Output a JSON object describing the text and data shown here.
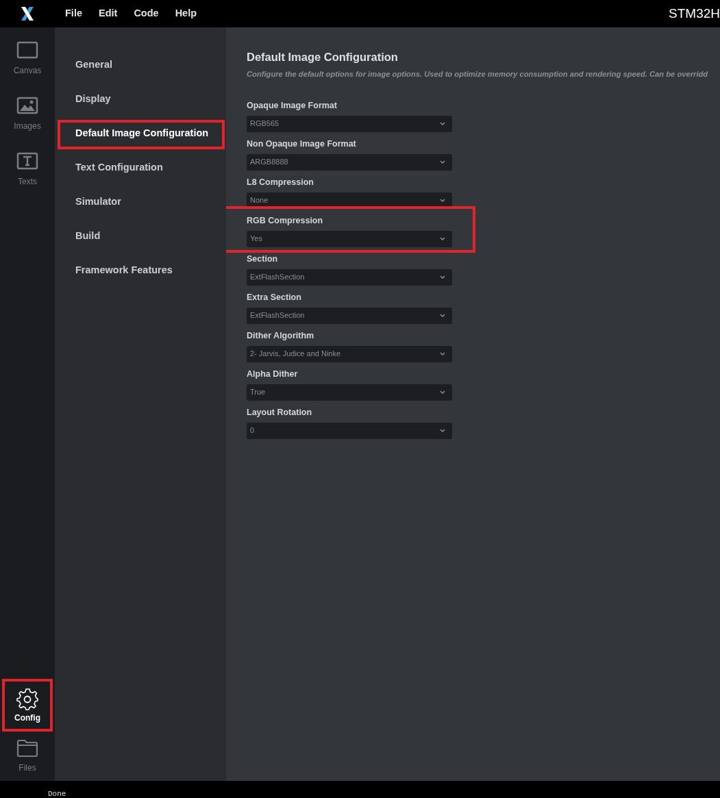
{
  "menu_bar": {
    "items": [
      "File",
      "Edit",
      "Code",
      "Help"
    ],
    "title": "STM32H"
  },
  "tool_rail": {
    "items": [
      {
        "kind": "canvas",
        "label": "Canvas",
        "selected": false,
        "highlighted": false
      },
      {
        "kind": "images",
        "label": "Images",
        "selected": false,
        "highlighted": false
      },
      {
        "kind": "texts",
        "label": "Texts",
        "selected": false,
        "highlighted": false
      }
    ],
    "bottom_items": [
      {
        "kind": "config",
        "label": "Config",
        "selected": true,
        "highlighted": true
      },
      {
        "kind": "files",
        "label": "Files",
        "selected": false,
        "highlighted": false
      }
    ]
  },
  "config_nav": [
    {
      "label": "General",
      "selected": false,
      "highlighted": false
    },
    {
      "label": "Display",
      "selected": false,
      "highlighted": false
    },
    {
      "label": "Default Image Configuration",
      "selected": true,
      "highlighted": true
    },
    {
      "label": "Text Configuration",
      "selected": false,
      "highlighted": false
    },
    {
      "label": "Simulator",
      "selected": false,
      "highlighted": false
    },
    {
      "label": "Build",
      "selected": false,
      "highlighted": false
    },
    {
      "label": "Framework Features",
      "selected": false,
      "highlighted": false
    }
  ],
  "section": {
    "title": "Default Image Configuration",
    "description": "Configure the default options for image options. Used to optimize memory consumption and rendering speed. Can be overridd"
  },
  "fields": [
    {
      "label": "Opaque Image Format",
      "value": "RGB565",
      "highlighted": false
    },
    {
      "label": "Non Opaque Image Format",
      "value": "ARGB8888",
      "highlighted": false
    },
    {
      "label": "L8 Compression",
      "value": "None",
      "highlighted": false
    },
    {
      "label": "RGB Compression",
      "value": "Yes",
      "highlighted": true
    },
    {
      "label": "Section",
      "value": "ExtFlashSection",
      "highlighted": false
    },
    {
      "label": "Extra Section",
      "value": "ExtFlashSection",
      "highlighted": false
    },
    {
      "label": "Dither Algorithm",
      "value": "2- Jarvis, Judice and Ninke",
      "highlighted": false
    },
    {
      "label": "Alpha Dither",
      "value": "True",
      "highlighted": false
    },
    {
      "label": "Layout Rotation",
      "value": "0",
      "highlighted": false
    }
  ],
  "console": {
    "lines": [
      "Done"
    ]
  }
}
